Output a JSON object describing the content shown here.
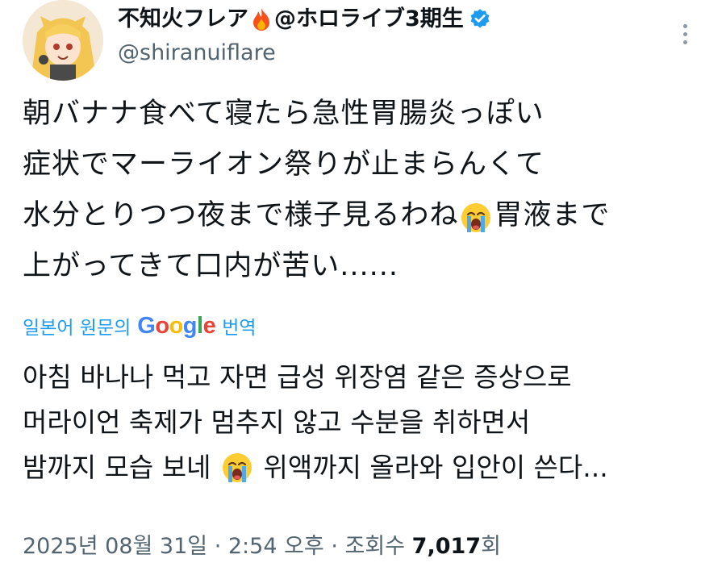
{
  "author": {
    "display_name_prefix": "不知火フレア",
    "display_name_icon": "fire-icon",
    "display_name_suffix": "@ホロライブ3期生",
    "verified_icon": "verified-badge-icon",
    "handle": "@shiranuiflare"
  },
  "more_menu_icon": "more-vertical-icon",
  "tweet": {
    "lines": [
      {
        "text": "朝バナナ食べて寝たら急性胃腸炎っぽい"
      },
      {
        "text": "症状でマーライオン祭りが止まらんくて"
      },
      {
        "before": "水分とりつつ夜まで様子見るわね",
        "emoji": "loudly-crying-face-icon",
        "after": "胃液まで"
      },
      {
        "text": "上がってきて口内が苦い......"
      }
    ]
  },
  "translation": {
    "label_prefix": "일본어 원문의",
    "google_letters": [
      "G",
      "o",
      "o",
      "g",
      "l",
      "e"
    ],
    "label_suffix": "번역",
    "link_color": "#1d9bf0",
    "lines": [
      {
        "text": "아침 바나나 먹고 자면 급성 위장염 같은 증상으로"
      },
      {
        "text": "머라이언 축제가 멈추지 않고 수분을 취하면서"
      },
      {
        "before": "밤까지 모습 보네 ",
        "emoji": "loudly-crying-face-icon",
        "after": " 위액까지 올라와 입안이 쓴다..."
      }
    ]
  },
  "meta": {
    "date": "2025년 08월 31일",
    "separator": " · ",
    "time": "2:54 오후",
    "views_label": "조회수",
    "views_count": "7,017",
    "views_unit": "회"
  },
  "colors": {
    "text": "#0f1419",
    "secondary": "#536471",
    "verified": "#1d9bf0"
  }
}
